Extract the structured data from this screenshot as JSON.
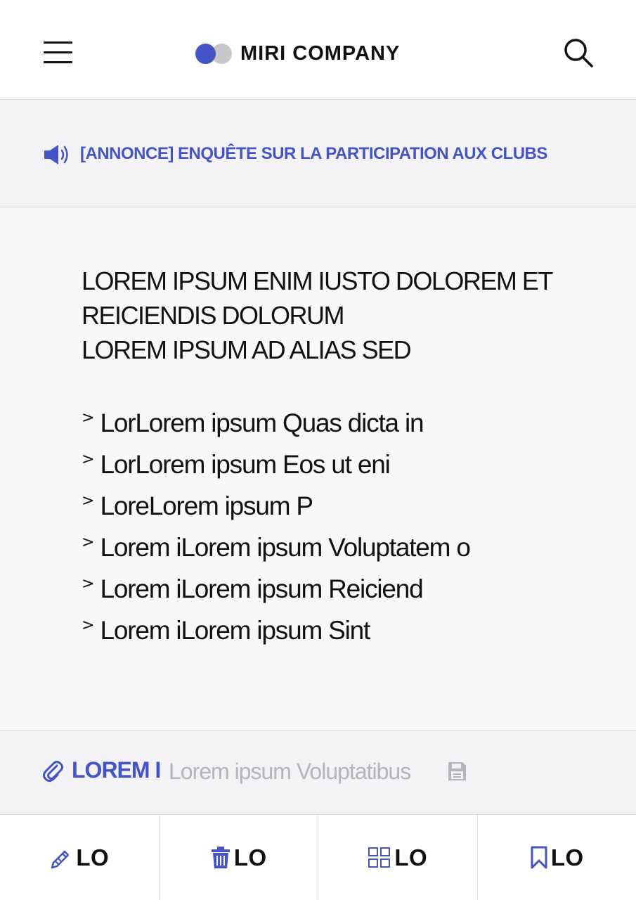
{
  "header": {
    "brand": "MIRI COMPANY",
    "menu_icon": "hamburger-menu-icon",
    "search_icon": "search-icon"
  },
  "announcement": {
    "icon": "megaphone-icon",
    "text": "[ANNONCE] ENQUÊTE SUR LA PARTICIPATION AUX CLUBS"
  },
  "main": {
    "heading_lines": [
      "LOREM IPSUM ENIM IUSTO DOLOREM ET",
      "REICIENDIS DOLORUM",
      "LOREM IPSUM AD ALIAS SED"
    ],
    "list_marker": ">",
    "items": [
      "LorLorem ipsum Quas dicta in",
      "LorLorem ipsum Eos ut eni",
      "LoreLorem ipsum P",
      "Lorem iLorem ipsum Voluptatem o",
      "Lorem iLorem ipsum Reiciend",
      "Lorem iLorem ipsum Sint"
    ]
  },
  "attachment": {
    "icon": "paperclip-icon",
    "label": "LOREM I",
    "file_name": "Lorem ipsum Voluptatibus",
    "save_icon": "floppy-disk-icon"
  },
  "bottom_bar": {
    "tabs": [
      {
        "icon": "pencil-icon",
        "label": "LO"
      },
      {
        "icon": "trash-icon",
        "label": "LO"
      },
      {
        "icon": "grid-icon",
        "label": "LO"
      },
      {
        "icon": "bookmark-icon",
        "label": "LO"
      }
    ]
  },
  "colors": {
    "accent": "#4453c6",
    "muted_text": "#b5b5ba",
    "background": "#f8f8fa",
    "border": "#dcdce0"
  }
}
